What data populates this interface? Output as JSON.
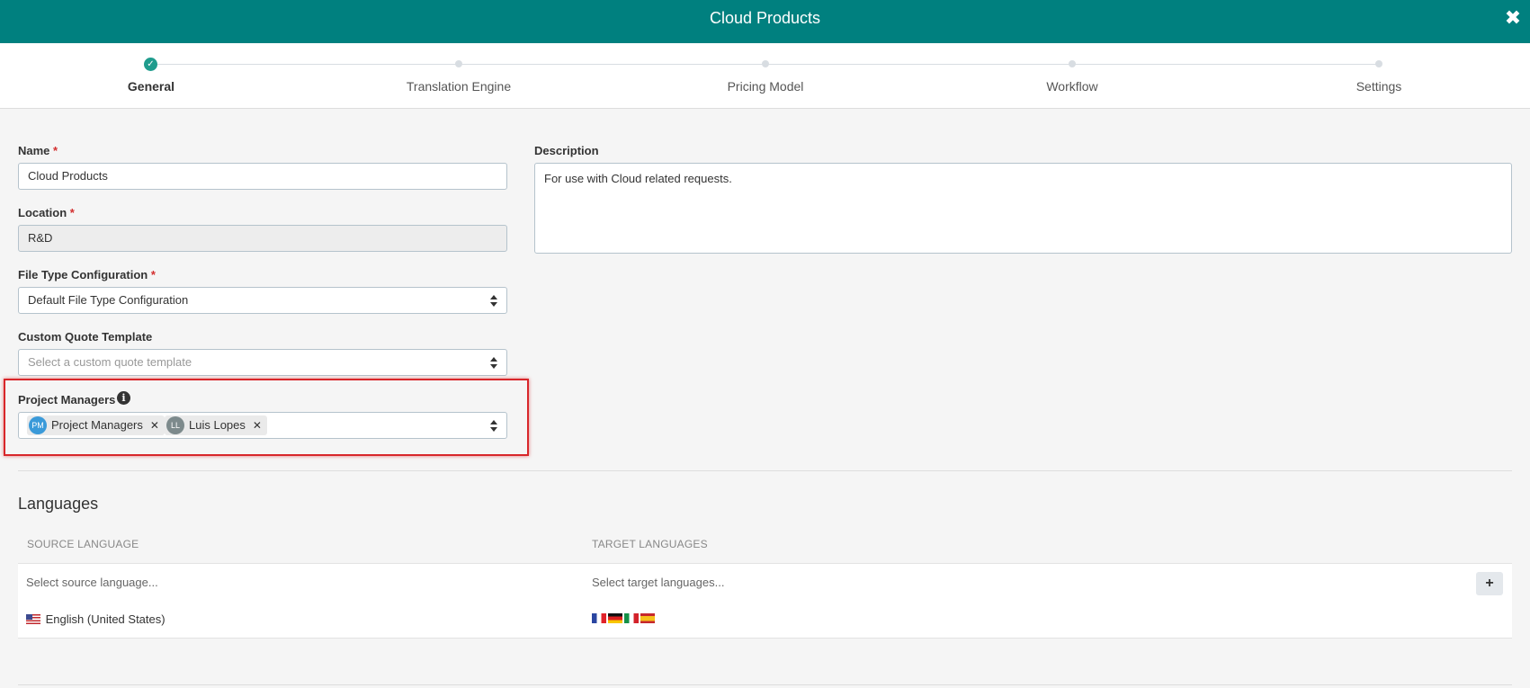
{
  "window": {
    "title": "Cloud Products"
  },
  "steps": [
    {
      "label": "General",
      "state": "complete"
    },
    {
      "label": "Translation Engine",
      "state": "pending"
    },
    {
      "label": "Pricing Model",
      "state": "pending"
    },
    {
      "label": "Workflow",
      "state": "pending"
    },
    {
      "label": "Settings",
      "state": "pending"
    }
  ],
  "form": {
    "name": {
      "label": "Name",
      "value": "Cloud Products",
      "required": "*"
    },
    "location": {
      "label": "Location",
      "value": "R&D",
      "required": "*"
    },
    "file_type": {
      "label": "File Type Configuration",
      "value": "Default File Type Configuration",
      "required": "*"
    },
    "quote_template": {
      "label": "Custom Quote Template",
      "placeholder": "Select a custom quote template"
    },
    "description": {
      "label": "Description",
      "value": "For use with Cloud related requests."
    },
    "project_managers": {
      "label": "Project Managers",
      "tags": [
        {
          "initials": "PM",
          "name": "Project Managers",
          "color": "#3a9ad9"
        },
        {
          "initials": "LL",
          "name": "Luis Lopes",
          "color": "#7d8a8c"
        }
      ]
    }
  },
  "languages": {
    "title": "Languages",
    "source_header": "SOURCE LANGUAGE",
    "target_header": "TARGET LANGUAGES",
    "source_placeholder": "Select source language...",
    "target_placeholder": "Select target languages...",
    "add_label": "+",
    "rows": [
      {
        "source": "English (United States)",
        "source_flag": "us-flag",
        "target_flags": [
          "fr-flag",
          "de-flag",
          "it-flag",
          "es-flag"
        ]
      }
    ]
  },
  "colors": {
    "header": "#00807f",
    "accent": "#1f9c8d",
    "highlight": "#d8262a"
  }
}
